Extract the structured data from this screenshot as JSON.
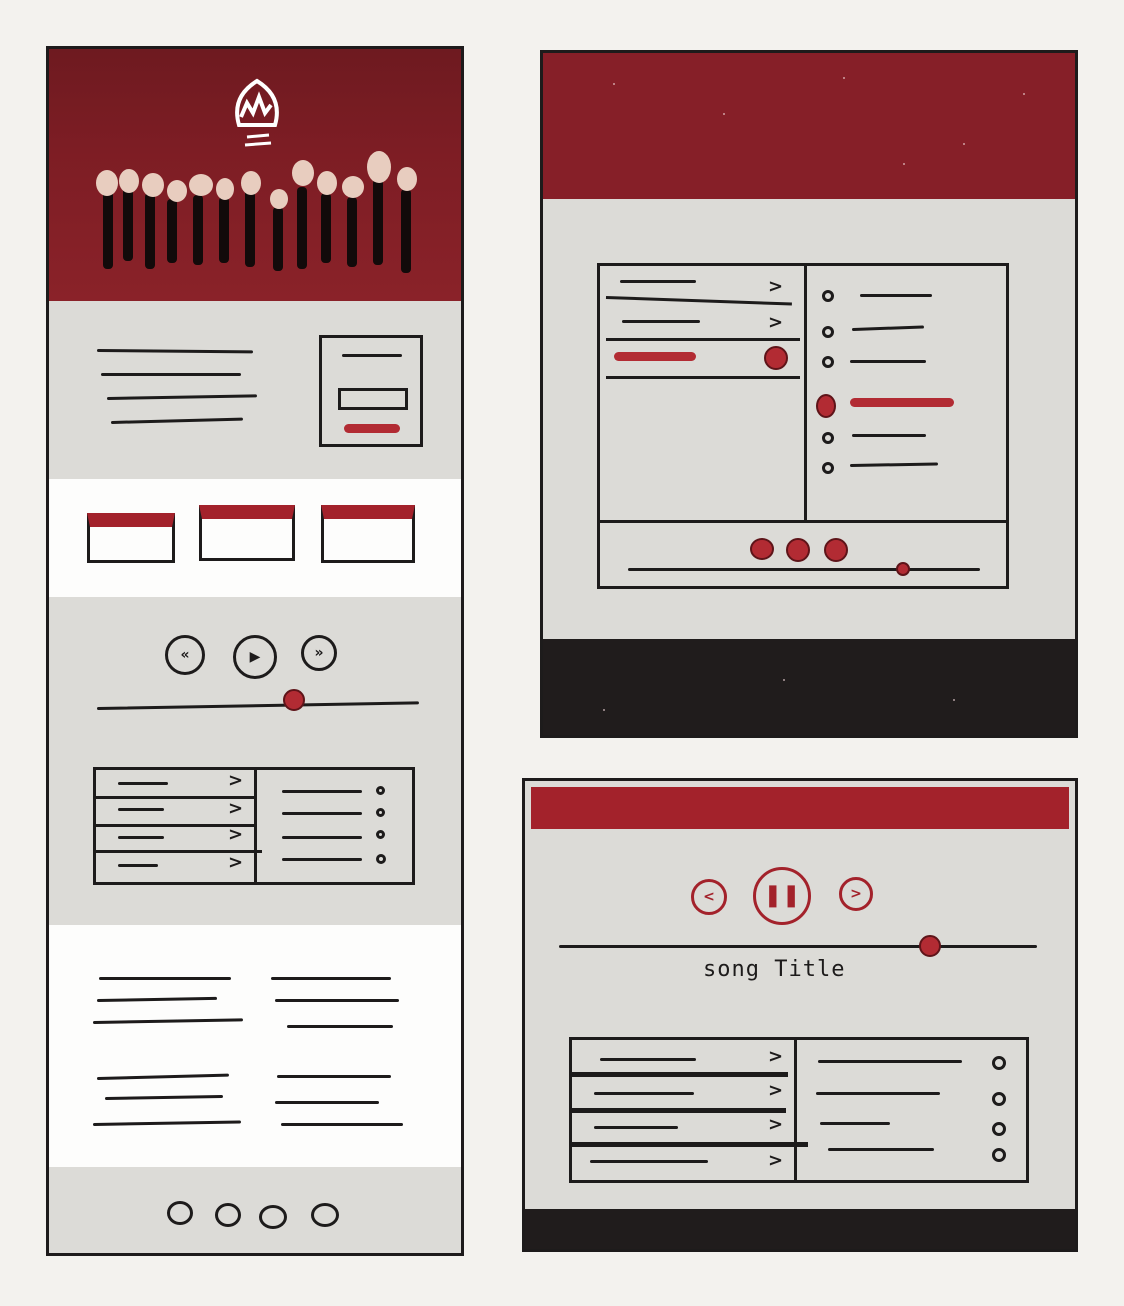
{
  "player": {
    "song_title": "song Title",
    "play_icon": "play-icon",
    "pause_icon": "pause-icon",
    "prev_icon": "rewind-icon",
    "next_icon": "fast-forward-icon"
  },
  "colors": {
    "brand_red": "#861f28",
    "accent_red": "#b22b33",
    "ink": "#1d1b1b",
    "paper": "#dcdbd7",
    "footer_dark": "#201c1c"
  }
}
